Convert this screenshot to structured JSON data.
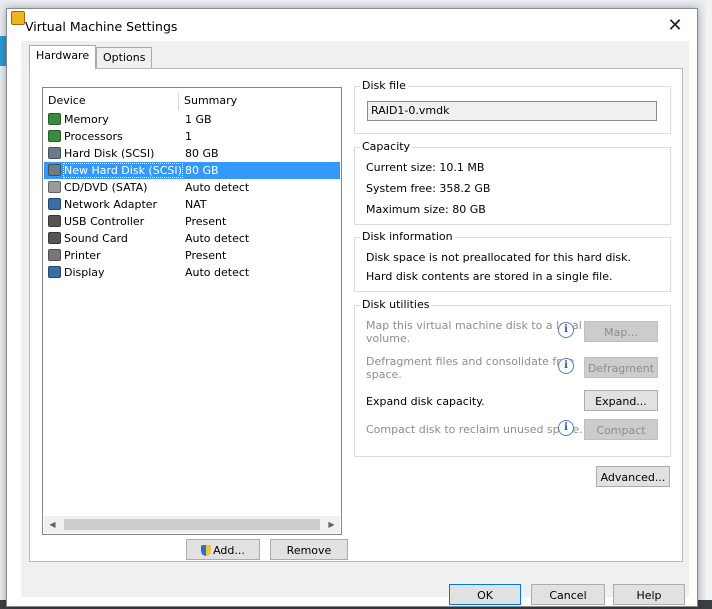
{
  "dialog": {
    "title": "Virtual Machine Settings",
    "close_glyph": "✕"
  },
  "tabs": [
    {
      "label": "Hardware"
    },
    {
      "label": "Options"
    }
  ],
  "device_list": {
    "columns": {
      "device": "Device",
      "summary": "Summary"
    },
    "rows": [
      {
        "name": "Memory",
        "summary": "1 GB",
        "icon": "memory-icon",
        "color": "#3b8a3b"
      },
      {
        "name": "Processors",
        "summary": "1",
        "icon": "processor-icon",
        "color": "#3b8a3b"
      },
      {
        "name": "Hard Disk (SCSI)",
        "summary": "80 GB",
        "icon": "hard-disk-icon",
        "color": "#6c7a89"
      },
      {
        "name": "New Hard Disk (SCSI)",
        "summary": "80 GB",
        "icon": "hard-disk-icon",
        "color": "#6c7a89",
        "selected": true
      },
      {
        "name": "CD/DVD (SATA)",
        "summary": "Auto detect",
        "icon": "cd-dvd-icon",
        "color": "#9a9a9a"
      },
      {
        "name": "Network Adapter",
        "summary": "NAT",
        "icon": "network-adapter-icon",
        "color": "#3a6ea5"
      },
      {
        "name": "USB Controller",
        "summary": "Present",
        "icon": "usb-controller-icon",
        "color": "#555555"
      },
      {
        "name": "Sound Card",
        "summary": "Auto detect",
        "icon": "sound-card-icon",
        "color": "#555555"
      },
      {
        "name": "Printer",
        "summary": "Present",
        "icon": "printer-icon",
        "color": "#777777"
      },
      {
        "name": "Display",
        "summary": "Auto detect",
        "icon": "display-icon",
        "color": "#3a6ea5"
      }
    ]
  },
  "device_buttons": {
    "add": "Add...",
    "remove": "Remove"
  },
  "disk_file": {
    "label": "Disk file",
    "value": "RAID1-0.vmdk"
  },
  "capacity": {
    "label": "Capacity",
    "current_size": "Current size:  10.1 MB",
    "system_free": "System free:  358.2 GB",
    "maximum_size": "Maximum size:  80 GB"
  },
  "disk_information": {
    "label": "Disk information",
    "line1": "Disk space is not preallocated for this hard disk.",
    "line2": "Hard disk contents are stored in a single file."
  },
  "disk_utilities": {
    "label": "Disk utilities",
    "map_text_1": "Map this virtual machine disk to a local",
    "map_text_2": "volume.",
    "map_button": "Map...",
    "defrag_text_1": "Defragment files and consolidate free",
    "defrag_text_2": "space.",
    "defrag_button": "Defragment",
    "expand_text": "Expand disk capacity.",
    "expand_button": "Expand...",
    "compact_text": "Compact disk to reclaim unused space.",
    "compact_button": "Compact"
  },
  "advanced_button": "Advanced...",
  "footer": {
    "ok": "OK",
    "cancel": "Cancel",
    "help": "Help"
  },
  "colors": {
    "accent": "#3399ff",
    "default_button_border": "#0078d7"
  }
}
